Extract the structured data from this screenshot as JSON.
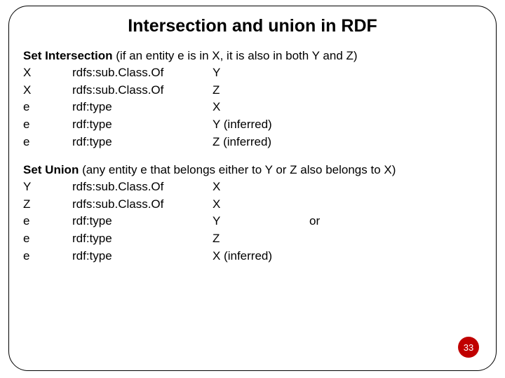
{
  "title": "Intersection and union in RDF",
  "intersection": {
    "heading_bold": "Set Intersection",
    "heading_rest": " (if an entity e is in X, it is also in both  Y and Z)",
    "rows": [
      {
        "s": "X",
        "p": "rdfs:sub.Class.Of",
        "o": "Y",
        "extra": ""
      },
      {
        "s": "X",
        "p": "rdfs:sub.Class.Of",
        "o": "Z",
        "extra": ""
      },
      {
        "s": "e",
        "p": "rdf:type",
        "o": "X",
        "extra": ""
      },
      {
        "s": "e",
        "p": "rdf:type",
        "o": "Y (inferred)",
        "extra": ""
      },
      {
        "s": "e",
        "p": "rdf:type",
        "o": "Z (inferred)",
        "extra": ""
      }
    ]
  },
  "union": {
    "heading_bold": "Set Union",
    "heading_rest": " (any entity e that belongs either to Y or Z also belongs to X)",
    "rows": [
      {
        "s": "Y",
        "p": "rdfs:sub.Class.Of",
        "o": "X",
        "extra": ""
      },
      {
        "s": "Z",
        "p": "rdfs:sub.Class.Of",
        "o": "X",
        "extra": ""
      },
      {
        "s": "e",
        "p": "rdf:type",
        "o": "Y",
        "extra": "or"
      },
      {
        "s": "e",
        "p": "rdf:type",
        "o": "Z",
        "extra": ""
      },
      {
        "s": "e",
        "p": "rdf:type",
        "o": "X (inferred)",
        "extra": ""
      }
    ]
  },
  "page_number": "33"
}
